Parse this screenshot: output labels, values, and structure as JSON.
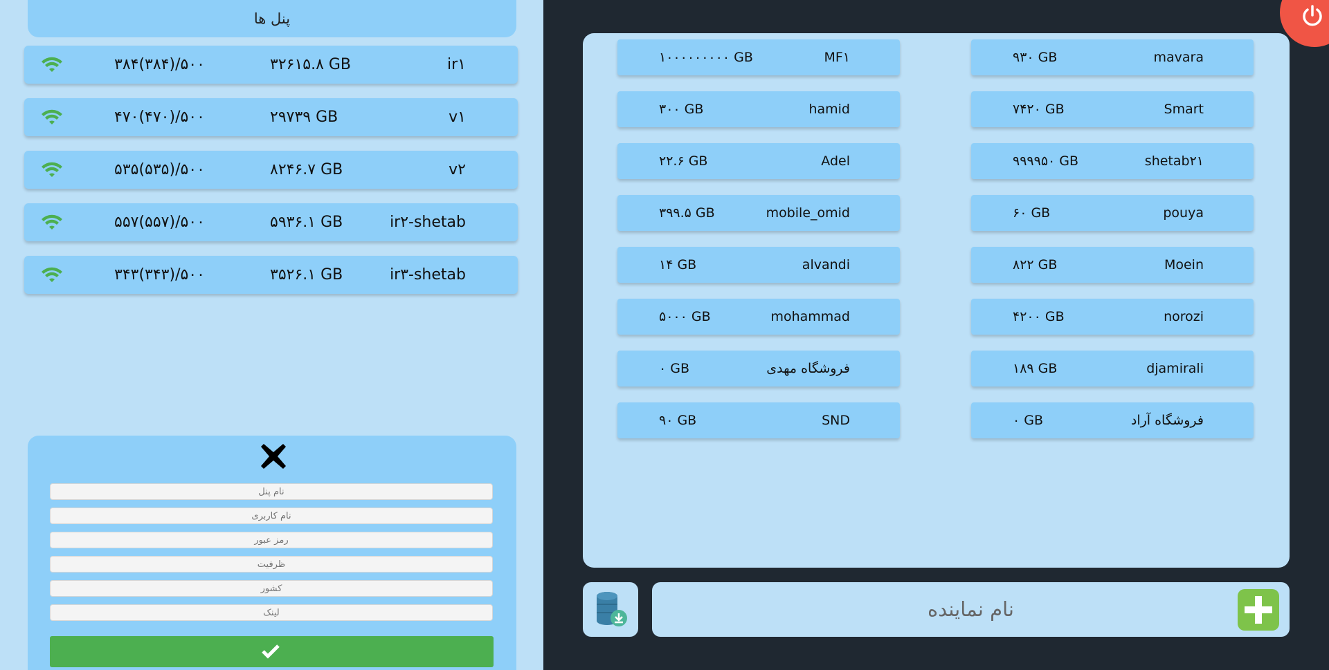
{
  "panels_title": "پنل ها",
  "servers": [
    {
      "name": "ir۱",
      "volume": "۳۲۶۱۵.۸ GB",
      "users": "۳۸۴(۳۸۴)/۵۰۰"
    },
    {
      "name": "v۱",
      "volume": "۲۹۷۳۹ GB",
      "users": "۴۷۰(۴۷۰)/۵۰۰"
    },
    {
      "name": "v۲",
      "volume": "۸۲۴۶.۷ GB",
      "users": "۵۳۵(۵۳۵)/۵۰۰"
    },
    {
      "name": "ir۲-shetab",
      "volume": "۵۹۳۶.۱ GB",
      "users": "۵۵۷(۵۵۷)/۵۰۰"
    },
    {
      "name": "ir۳-shetab",
      "volume": "۳۵۲۶.۱ GB",
      "users": "۳۴۳(۳۴۳)/۵۰۰"
    }
  ],
  "form": {
    "panel_name_placeholder": "نام پنل",
    "username_placeholder": "نام کاربری",
    "password_placeholder": "رمز عبور",
    "capacity_placeholder": "ظرفیت",
    "country_placeholder": "کشور",
    "link_placeholder": "لینک"
  },
  "agents_left": [
    {
      "name": "MF۱",
      "volume": "۱۰۰۰۰۰۰۰۰۰ GB"
    },
    {
      "name": "hamid",
      "volume": "۳۰۰ GB"
    },
    {
      "name": "Adel",
      "volume": "۲۲.۶ GB"
    },
    {
      "name": "mobile_omid",
      "volume": "۳۹۹.۵ GB"
    },
    {
      "name": "alvandi",
      "volume": "۱۴ GB"
    },
    {
      "name": "mohammad",
      "volume": "۵۰۰۰ GB"
    },
    {
      "name": "فروشگاه مهدی",
      "volume": "۰ GB"
    },
    {
      "name": "SND",
      "volume": "۹۰ GB"
    }
  ],
  "agents_right": [
    {
      "name": "mavara",
      "volume": "۹۳۰ GB"
    },
    {
      "name": "Smart",
      "volume": "۷۴۲۰ GB"
    },
    {
      "name": "shetab۲۱",
      "volume": "۹۹۹۹۵۰ GB"
    },
    {
      "name": "pouya",
      "volume": "۶۰ GB"
    },
    {
      "name": "Moein",
      "volume": "۸۲۲ GB"
    },
    {
      "name": "norozi",
      "volume": "۴۲۰۰ GB"
    },
    {
      "name": "djamirali",
      "volume": "۱۸۹ GB"
    },
    {
      "name": "فروشگاه آراد",
      "volume": "۰ GB"
    }
  ],
  "add_agent_placeholder": "نام نماینده",
  "icons": {
    "wifi": "wifi-icon",
    "close": "close-icon",
    "check": "check-icon",
    "power": "power-icon",
    "database": "database-download-icon",
    "plus": "plus-icon"
  },
  "colors": {
    "accent_card": "#8ecff9",
    "panel_bg": "#bde0f7",
    "dark_bg": "#1f2831",
    "wifi_green": "#4caf50",
    "submit_green": "#4caf50",
    "power_red": "#f05545",
    "plus_green": "#7ec34a"
  }
}
